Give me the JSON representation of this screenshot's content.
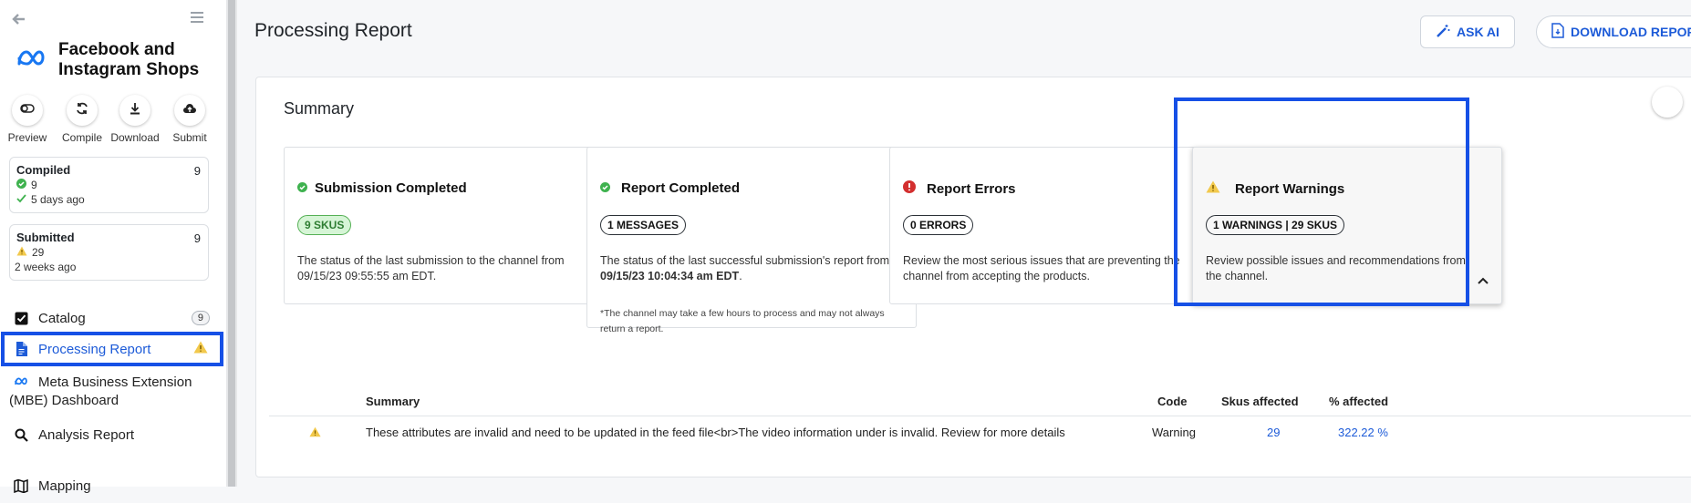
{
  "sidebar": {
    "brand": "Facebook and Instagram Shops",
    "actions": [
      {
        "label": "Preview",
        "icon": "toggle-icon"
      },
      {
        "label": "Compile",
        "icon": "refresh-icon"
      },
      {
        "label": "Download",
        "icon": "download-icon"
      },
      {
        "label": "Submit",
        "icon": "cloud-upload-icon"
      }
    ],
    "compiled": {
      "title": "Compiled",
      "count": "9",
      "line1": "9",
      "line2": "5 days ago"
    },
    "submitted": {
      "title": "Submitted",
      "count": "9",
      "line1": "29",
      "line2": "2 weeks ago"
    },
    "nav": [
      {
        "label": "Catalog",
        "count": "9"
      },
      {
        "label": "Processing Report"
      },
      {
        "label": "Meta Business Extension (MBE) Dashboard"
      },
      {
        "label": "Analysis Report"
      },
      {
        "label": "Mapping"
      }
    ]
  },
  "header": {
    "title": "Processing Report",
    "ask_ai": "ASK AI",
    "download": "DOWNLOAD REPORT"
  },
  "summary": {
    "title": "Summary",
    "cards": [
      {
        "title": "Submission Completed",
        "pill": "9 SKUS",
        "desc": "The status of the last submission to the channel from 09/15/23 09:55:55 am EDT."
      },
      {
        "title": "Report Completed",
        "pill": "1 MESSAGES",
        "desc_prefix": "The status of the last successful submission's report from ",
        "desc_bold": "09/15/23 10:04:34 am EDT",
        "desc_suffix": ".",
        "note": "*The channel may take a few hours to process and may not always return a report."
      },
      {
        "title": "Report Errors",
        "pill": "0 ERRORS",
        "desc": "Review the most serious issues that are preventing the channel from accepting the products."
      },
      {
        "title": "Report Warnings",
        "pill": "1 WARNINGS | 29 SKUS",
        "desc": "Review possible issues and recommendations from the channel."
      }
    ]
  },
  "table": {
    "headers": {
      "summary": "Summary",
      "code": "Code",
      "skus": "Skus affected",
      "pct": "% affected"
    },
    "rows": [
      {
        "summary": "These attributes are invalid and need to be updated in the feed file<br>The video information under is invalid. Review for more details",
        "code": "Warning",
        "skus": "29",
        "pct": "322.22 %"
      }
    ]
  },
  "colors": {
    "accent": "#1d5bd8",
    "highlight": "#1650e6",
    "success": "#3fb24f",
    "warning": "#f2c94c",
    "error": "#d32f2f"
  }
}
